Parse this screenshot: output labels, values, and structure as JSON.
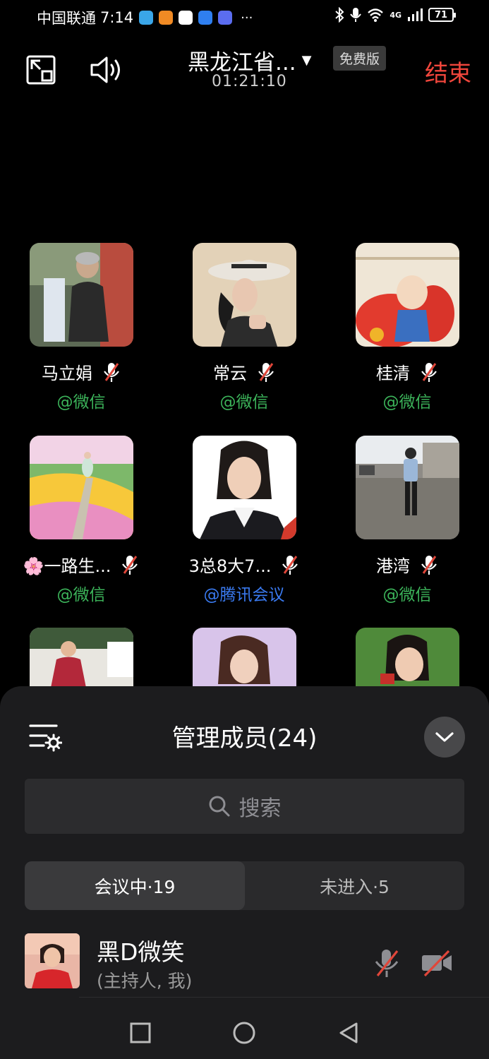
{
  "status_bar": {
    "carrier": "中国联通",
    "time": "7:14",
    "more": "···",
    "network": "4G",
    "battery": "71"
  },
  "meeting": {
    "title": "黑龙江省...",
    "badge": "免费版",
    "duration": "01:21:10",
    "end_label": "结束"
  },
  "participants": [
    {
      "name": "马立娟",
      "via": "@微信",
      "muted": true,
      "via_color": "#3cb45a"
    },
    {
      "name": "常云",
      "via": "@微信",
      "muted": true,
      "via_color": "#3cb45a"
    },
    {
      "name": "桂清",
      "via": "@微信",
      "muted": true,
      "via_color": "#3cb45a"
    },
    {
      "name": "🌸一路生...",
      "via": "@微信",
      "muted": true,
      "via_color": "#3cb45a"
    },
    {
      "name": "3总8大7...",
      "via": "@腾讯会议",
      "muted": true,
      "via_color": "#3a7af0"
    },
    {
      "name": "港湾",
      "via": "@微信",
      "muted": true,
      "via_color": "#3cb45a"
    }
  ],
  "panel": {
    "title": "管理成员(24)",
    "search_placeholder": "搜索",
    "tab_in_meeting": "会议中·19",
    "tab_not_joined": "未进入·5"
  },
  "member": {
    "name": "黑D微笑",
    "role": "(主持人, 我)"
  },
  "colors": {
    "end_red": "#f0463c",
    "wechat_green": "#3cb45a",
    "tencent_blue": "#3a7af0",
    "muted_red": "#e0463a"
  }
}
